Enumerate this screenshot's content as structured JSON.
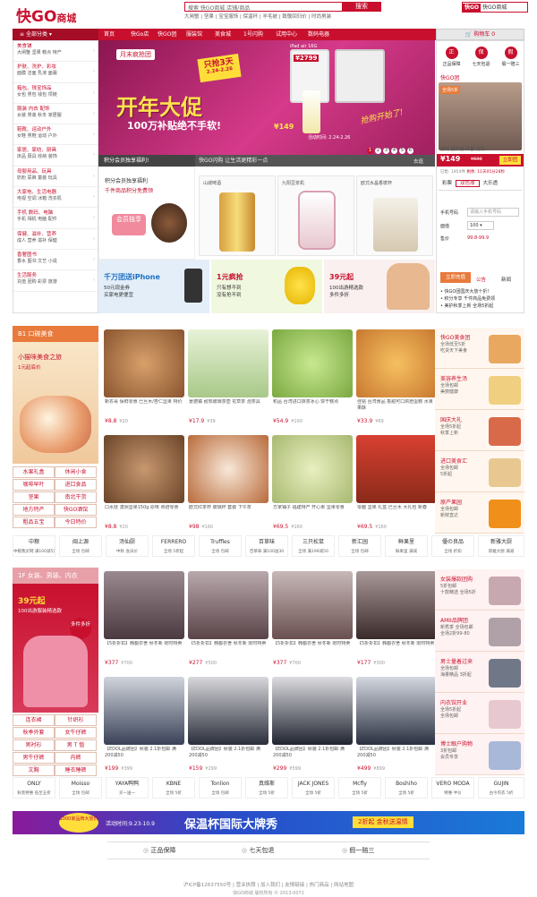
{
  "header": {
    "logo": "快GO",
    "logo_suffix": "商城",
    "search_placeholder": "搜索  快GO商城 店铺/商品",
    "search_button": "搜索",
    "hot_words": "大闸蟹 | 坚果 | 宝宝服饰 | 保温杯 | 羊毛被 | 致敬回归价 | 时尚男装",
    "mini_logo": "快GO",
    "mini_text": "快GO商城"
  },
  "nav": {
    "all": "全部分类",
    "items": [
      "首页",
      "快Go店",
      "快GO团",
      "服装馆",
      "美食城",
      "1号闪购",
      "试用中心",
      "数码电器"
    ],
    "cart": "购物车 0"
  },
  "categories": [
    {
      "title": "美食铺",
      "sub": "大闸蟹 坚果 糕点 特产"
    },
    {
      "title": "护肤、洗护、彩妆",
      "sub": "面膜 洁面 乳液 面霜"
    },
    {
      "title": "箱包、珠宝饰品",
      "sub": "女包 男包 钱包 项链"
    },
    {
      "title": "服装 内衣 配饰",
      "sub": "女装 男装 秋冬 家居服"
    },
    {
      "title": "鞋靴、运动户外",
      "sub": "女鞋 男鞋 运动 户外"
    },
    {
      "title": "家居、家纺、厨具",
      "sub": "床品 厨具 收纳 装饰"
    },
    {
      "title": "母婴用品、玩具",
      "sub": "奶粉 尿裤 童装 玩具"
    },
    {
      "title": "大家电、生活电器",
      "sub": "电视 空调 冰箱 洗衣机"
    },
    {
      "title": "手机 数码、电脑",
      "sub": "手机 相机 电脑 配件"
    },
    {
      "title": "保健、滋补、营养",
      "sub": "成人 营养 滋补 保健"
    },
    {
      "title": "香奢图书",
      "sub": "香水 图书 文艺 小说"
    },
    {
      "title": "生活服务",
      "sub": "充值 团购 彩票 旅游"
    }
  ],
  "banner": {
    "brand_tag": "月末疯抢团",
    "badge": "只抢3天",
    "badge_date": "2.24-2.26",
    "ipad_label": "iPad air 16G",
    "ipad_price": "¥2799",
    "title": "开年大促",
    "subtitle": "100万补贴绝不手软!",
    "note": "活动时间: 2.24-2.26",
    "script_text": "抢购开始了!",
    "perfume_price": "¥149",
    "slides": [
      "1",
      "2",
      "3",
      "4",
      "5",
      "6"
    ]
  },
  "right_panel": {
    "guarantees": [
      "正品保障",
      "七天包退",
      "假一赔三"
    ],
    "icons": [
      "正",
      "保",
      "假"
    ],
    "tabs": [
      "快GO团",
      "推荐",
      "热销"
    ],
    "group_tag": "全场5折",
    "group_name": "播特 夏秋装 外套 男款",
    "price": "¥149",
    "orig": "¥699",
    "buy": "立即团",
    "sold": "已售: 1954件",
    "timer": "剩余: 11天05分28秒",
    "sub_tabs": [
      "彩票",
      "双色球",
      "大乐透"
    ],
    "phone_label": "手机号码",
    "phone_placeholder": "请输入手机号码",
    "amount_label": "面值",
    "amount_value": "100",
    "price_label": "售价",
    "price_value": "99.8-99.9",
    "recharge": "立即充值",
    "tabs2": [
      "公告",
      "新闻"
    ],
    "notices": [
      "快GO团国庆大放十折!",
      "积分专享 千件商品免费领",
      "美护秋季上新 全场5折起"
    ]
  },
  "members": {
    "tab1": "积分会员独享福利!",
    "tab2": "快GO闪购  让生活更精彩一点",
    "more": "去逛",
    "title": "积分会员独享福利",
    "sub": "千件商品积分免费领",
    "badge": "会员独享",
    "cards": [
      "山城啤酒",
      "九阳豆浆机",
      "欧式水晶香槟杯"
    ]
  },
  "promos": [
    {
      "title": "千万团送iPhone",
      "sub": "50元现金券\n买家电更便宜",
      "color": "#1f6fc2"
    },
    {
      "title": "1元疯抢",
      "sub": "只有想不到\n没有抢不到",
      "color": "#c8102e"
    },
    {
      "title": "39元起",
      "sub": "100出游精选款\n多件多折",
      "color": "#c8102e"
    }
  ],
  "food": {
    "section": "B1  口碗美食",
    "promo_title": "小猫咪美食之旅",
    "promo_sub": "1元起底价",
    "links": [
      "水果礼盒",
      "休闲小食",
      "咖啡早叶",
      "进口食品",
      "坚果",
      "南北干货",
      "地方特产",
      "快GO酒馆",
      "粗品五宝",
      "今日特价"
    ],
    "products": [
      {
        "desc": "新农哥 保鲜零食 巴旦木/杏仁坚果 特价",
        "price": "¥8.8",
        "old": "¥20"
      },
      {
        "desc": "景德镇 耐热玻璃茶壶 花草茶 泡茶具",
        "price": "¥17.9",
        "old": "¥39"
      },
      {
        "desc": "积品 台湾进口抹茶冰心 饼干糕点",
        "price": "¥54.9",
        "old": "¥100"
      },
      {
        "desc": "佳铭 台湾食品 香甜可口烘焙蛋糕 水果果酥",
        "price": "¥33.9",
        "old": "¥69"
      },
      {
        "desc": "口水娃 澳洲坚果150g 原味 熟焙零食",
        "price": "¥8.8",
        "old": "¥20"
      },
      {
        "desc": "欧式红茶杯 玻璃杯 套装 下午茶",
        "price": "¥98",
        "old": "¥160"
      },
      {
        "desc": "方家铺子 福建特产 开心果 坚果零食",
        "price": "¥69.5",
        "old": "¥160"
      },
      {
        "desc": "零趣 坚果 礼盒 巴旦木 大礼包 新春",
        "price": "¥69.5",
        "old": "¥160"
      }
    ],
    "side": [
      {
        "title": "快GO美食团",
        "sub": "全场低至5折\n吃货天下美食"
      },
      {
        "title": "美容养生汤",
        "sub": "全场包邮\n美丽健康"
      },
      {
        "title": "国庆大礼",
        "sub": "全场5折起\n秋季上新"
      },
      {
        "title": "进口美食汇",
        "sub": "全场包邮\n5折起"
      },
      {
        "title": "原产果园",
        "sub": "全场包邮\n新鲜直达"
      }
    ],
    "brands": [
      {
        "name": "中粮",
        "note": "中粮我买网 满100减5元"
      },
      {
        "name": "闽上源",
        "note": "全场 包邮"
      },
      {
        "name": "汤仙厨",
        "note": "中秋 会员价"
      },
      {
        "name": "FERRERO",
        "note": "全场 5折起"
      },
      {
        "name": "Truffles",
        "note": "全场 包邮"
      },
      {
        "name": "百草味",
        "note": "百草味 满100送30"
      },
      {
        "name": "三只松鼠",
        "note": "全场 满199减50"
      },
      {
        "name": "新汇园",
        "note": "全场 包邮"
      },
      {
        "name": "鲜果里",
        "note": "鲜果里 满减"
      },
      {
        "name": "優の良品",
        "note": "全场 折扣"
      },
      {
        "name": "新雅大厨",
        "note": "新雅大厨 满减"
      }
    ]
  },
  "clothing": {
    "section": "1F  女装、男装、内衣",
    "promo_price": "39元起",
    "promo_sub": "100出游服装精选款",
    "pill": "多件多折",
    "links": [
      "连衣裙",
      "针织衫",
      "秋季外套",
      "女牛仔裤",
      "男衬衫",
      "男 T 恤",
      "男牛仔裤",
      "内裤",
      "文胸",
      "睡衣睡裤"
    ],
    "products": [
      {
        "desc": "【5折折扣】韩都衣舍 秋冬新 限时特卖",
        "price": "¥377",
        "old": "¥700"
      },
      {
        "desc": "【5折折扣】韩都衣舍 秋冬新 限时特卖",
        "price": "¥277",
        "old": "¥500"
      },
      {
        "desc": "【5折折扣】韩都衣舍 秋冬新 限时特卖",
        "price": "¥377",
        "old": "¥700"
      },
      {
        "desc": "【5折折扣】韩都衣舍 秋冬新 限时特卖",
        "price": "¥177",
        "old": "¥300"
      },
      {
        "desc": "【EDOL品牌团】秋装 2.1折包邮 满200减50",
        "price": "¥199",
        "old": "¥399"
      },
      {
        "desc": "【EDOL品牌团】秋装 2.1折包邮 满200减50",
        "price": "¥159",
        "old": "¥299"
      },
      {
        "desc": "【EDOL品牌团】秋装 2.1折包邮 满200减50",
        "price": "¥299",
        "old": "¥599"
      },
      {
        "desc": "【EDOL品牌团】秋装 2.1折包邮 满200减50",
        "price": "¥499",
        "old": "¥899"
      }
    ],
    "side": [
      {
        "title": "女装爆款团购",
        "sub": "5折包邮\n十款精选 全场5折"
      },
      {
        "title": "AMII品牌团",
        "sub": "新秀季 全场包邮\n全场2折99-80"
      },
      {
        "title": "男士量着过来",
        "sub": "全场包邮\n海量精品 3折起"
      },
      {
        "title": "内衣馆开业",
        "sub": "全场5折起\n全场包邮"
      },
      {
        "title": "博士眼户购物",
        "sub": "3折包邮\n会员专享"
      }
    ],
    "brands": [
      {
        "name": "ONLY",
        "note": "秋装特惠 低至五折"
      },
      {
        "name": "Moisso",
        "note": "全场 包邮"
      },
      {
        "name": "YAYA鸭鸭",
        "note": "买一送一"
      },
      {
        "name": "KBNE",
        "note": "全场 5折"
      },
      {
        "name": "Tonlion",
        "note": "全场 包邮"
      },
      {
        "name": "真维斯",
        "note": "全场 5折"
      },
      {
        "name": "JACK JONES",
        "note": "全场 5折"
      },
      {
        "name": "Mcfly",
        "note": "全场 5折"
      },
      {
        "name": "Boshiho",
        "note": "全场 5折"
      },
      {
        "name": "VERO MODA",
        "note": "特惠 半价"
      },
      {
        "name": "GUJIN",
        "note": "古今内衣 5折"
      }
    ]
  },
  "bottom_banner": {
    "badge": "1000家品牌大放价",
    "date": "活动时间:9.23-10.9",
    "title": "保温杯国际大牌秀",
    "tag": "2折起  金秋送温情"
  },
  "guarantee_bar": [
    "正品保障",
    "七天包退",
    "假一赔三"
  ],
  "footer": {
    "links": "沪ICP备12637550号  |  营业执照  |  加入我们  |  友情链接  |  热门商品  |  网站地图",
    "copyright": "快GO商城 版权所有 © 2013-0072"
  },
  "colors": {
    "brand": "#c8102e",
    "food": "#e87a3b",
    "clothing": "#e8a0a8"
  }
}
